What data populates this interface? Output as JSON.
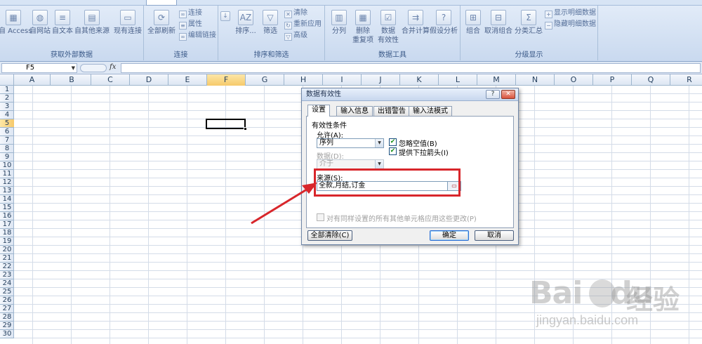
{
  "ribbon": {
    "groups": {
      "get_external": {
        "label": "获取外部数据",
        "buttons": [
          "自 Access",
          "自网站",
          "自文本",
          "自其他来源",
          "现有连接"
        ]
      },
      "connections": {
        "label": "连接",
        "refresh_all": "全部刷新",
        "small": [
          "连接",
          "属性",
          "编辑链接"
        ]
      },
      "sort_filter": {
        "label": "排序和筛选",
        "sort": "排序...",
        "filter": "筛选",
        "small": [
          "清除",
          "重新应用",
          "高级"
        ]
      },
      "data_tools": {
        "label": "数据工具",
        "buttons": [
          "分列",
          "删除\n重复项",
          "数据\n有效性",
          "合并计算",
          "假设分析"
        ]
      },
      "outline": {
        "label": "分级显示",
        "buttons": [
          "组合",
          "取消组合",
          "分类汇总"
        ],
        "small": [
          "显示明细数据",
          "隐藏明细数据"
        ]
      }
    }
  },
  "formula_bar": {
    "name_box": "F5",
    "fx": "fx",
    "formula": ""
  },
  "sheet": {
    "columns": [
      "A",
      "B",
      "C",
      "D",
      "E",
      "F",
      "G",
      "H",
      "I",
      "J",
      "K",
      "L",
      "M",
      "N",
      "O",
      "P",
      "Q",
      "R"
    ],
    "selected_column": "F",
    "rows": [
      "1",
      "2",
      "3",
      "4",
      "5",
      "6",
      "7",
      "8",
      "9",
      "10",
      "11",
      "12",
      "13",
      "14",
      "15",
      "16",
      "17",
      "18",
      "19",
      "20",
      "21",
      "22",
      "23",
      "24",
      "25",
      "26",
      "27",
      "28",
      "29",
      "30"
    ],
    "selected_row": "5",
    "active_cell": "F5"
  },
  "dialog": {
    "title": "数据有效性",
    "help": "?",
    "close": "✕",
    "tabs": [
      "设置",
      "输入信息",
      "出错警告",
      "输入法模式"
    ],
    "active_tab": "设置",
    "section_label": "有效性条件",
    "allow_label": "允许(A):",
    "allow_value": "序列",
    "ignore_blank_label": "忽略空值(B)",
    "ignore_blank_checked": true,
    "dropdown_label": "提供下拉箭头(I)",
    "dropdown_checked": true,
    "data_label": "数据(D):",
    "data_value": "介于",
    "source_label": "来源(S):",
    "source_value": "全款,月结,订金",
    "apply_all_label": "对有同样设置的所有其他单元格应用这些更改(P)",
    "apply_all_checked": false,
    "clear_all": "全部清除(C)",
    "ok": "确定",
    "cancel": "取消"
  },
  "annotation": {
    "highlight_color": "#d8262b"
  },
  "watermark": {
    "logo_prefix": "Bai",
    "logo_suffix": "du",
    "logo_cn": "经验",
    "url": "jingyan.baidu.com"
  }
}
